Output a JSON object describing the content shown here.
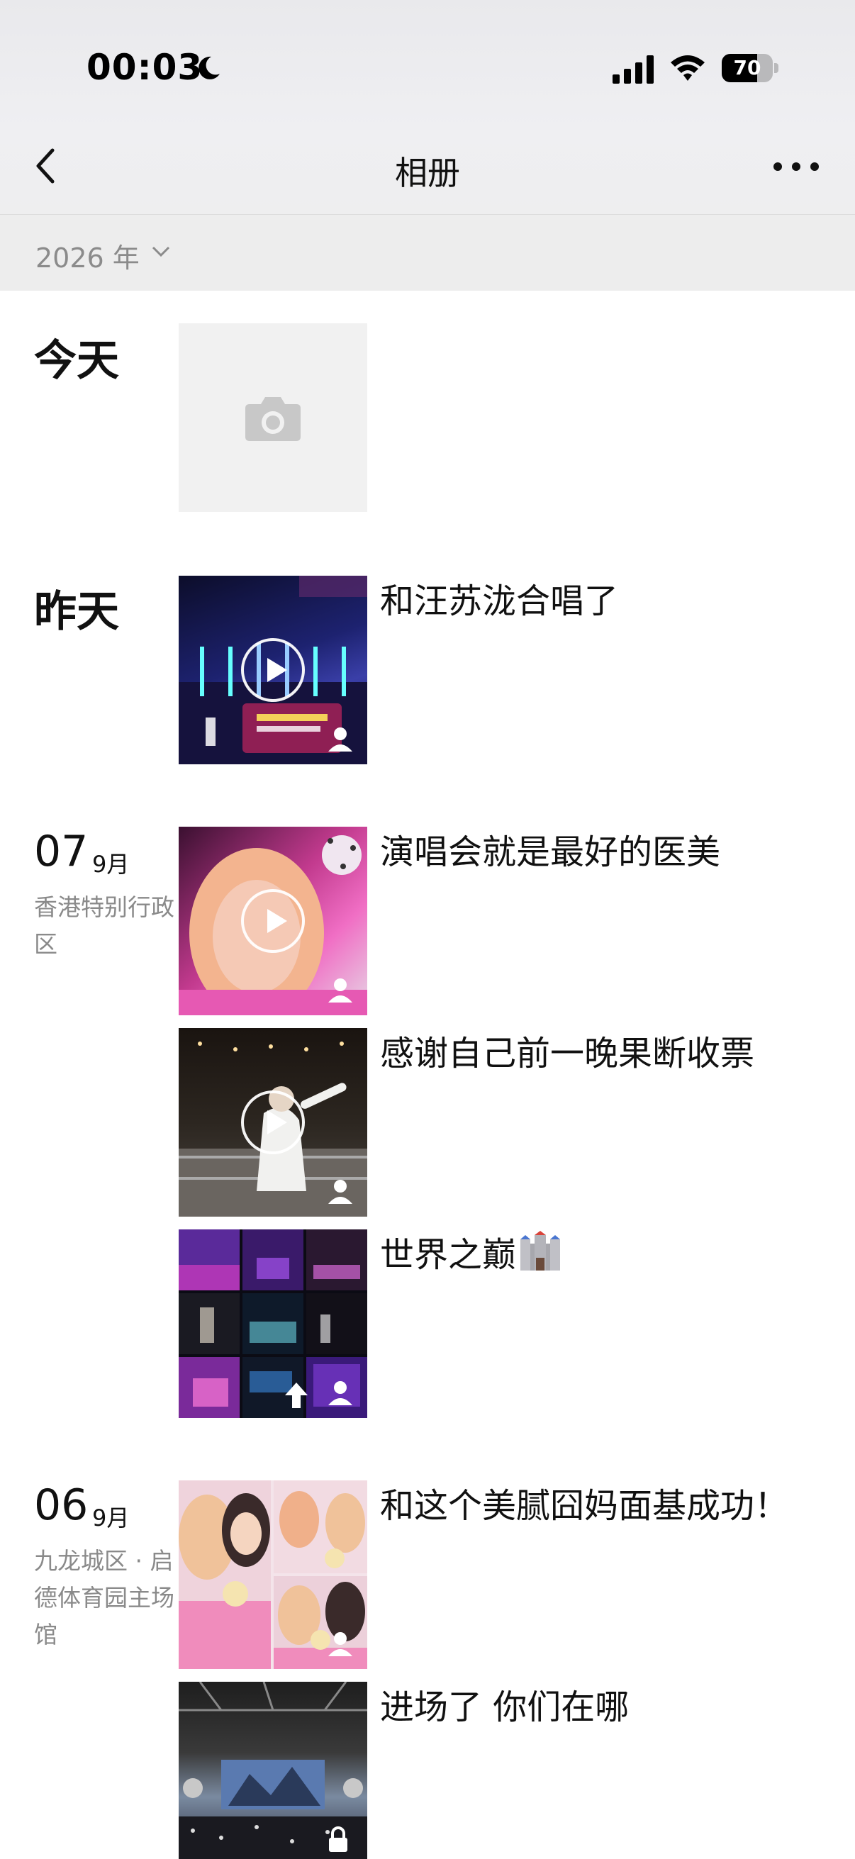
{
  "status_bar": {
    "time": "00:03",
    "battery": "70",
    "battery_level": 0.7
  },
  "nav": {
    "title": "相册"
  },
  "year_filter": {
    "label": "2026 年"
  },
  "sections": [
    {
      "date": "今天"
    },
    {
      "date": "昨天",
      "captions": [
        "和汪苏泷合唱了"
      ]
    },
    {
      "day": "07",
      "month": "9月",
      "location": "香港特别行政区",
      "captions": [
        "演唱会就是最好的医美",
        "感谢自己前一晚果断收票",
        "世界之巅"
      ]
    },
    {
      "day": "06",
      "month": "9月",
      "location": "九龙城区 · 启德体育园主场馆",
      "captions": [
        "和这个美腻囧妈面基成功！",
        "进场了 你们在哪"
      ]
    }
  ],
  "icons": {
    "back": "chevron-left-icon",
    "more": "more-dots-icon",
    "camera": "camera-icon",
    "play": "play-icon",
    "visibility": "contacts-icon",
    "upload": "upload-arrow-icon",
    "private": "lock-icon",
    "castle_emoji": "castle-icon"
  }
}
